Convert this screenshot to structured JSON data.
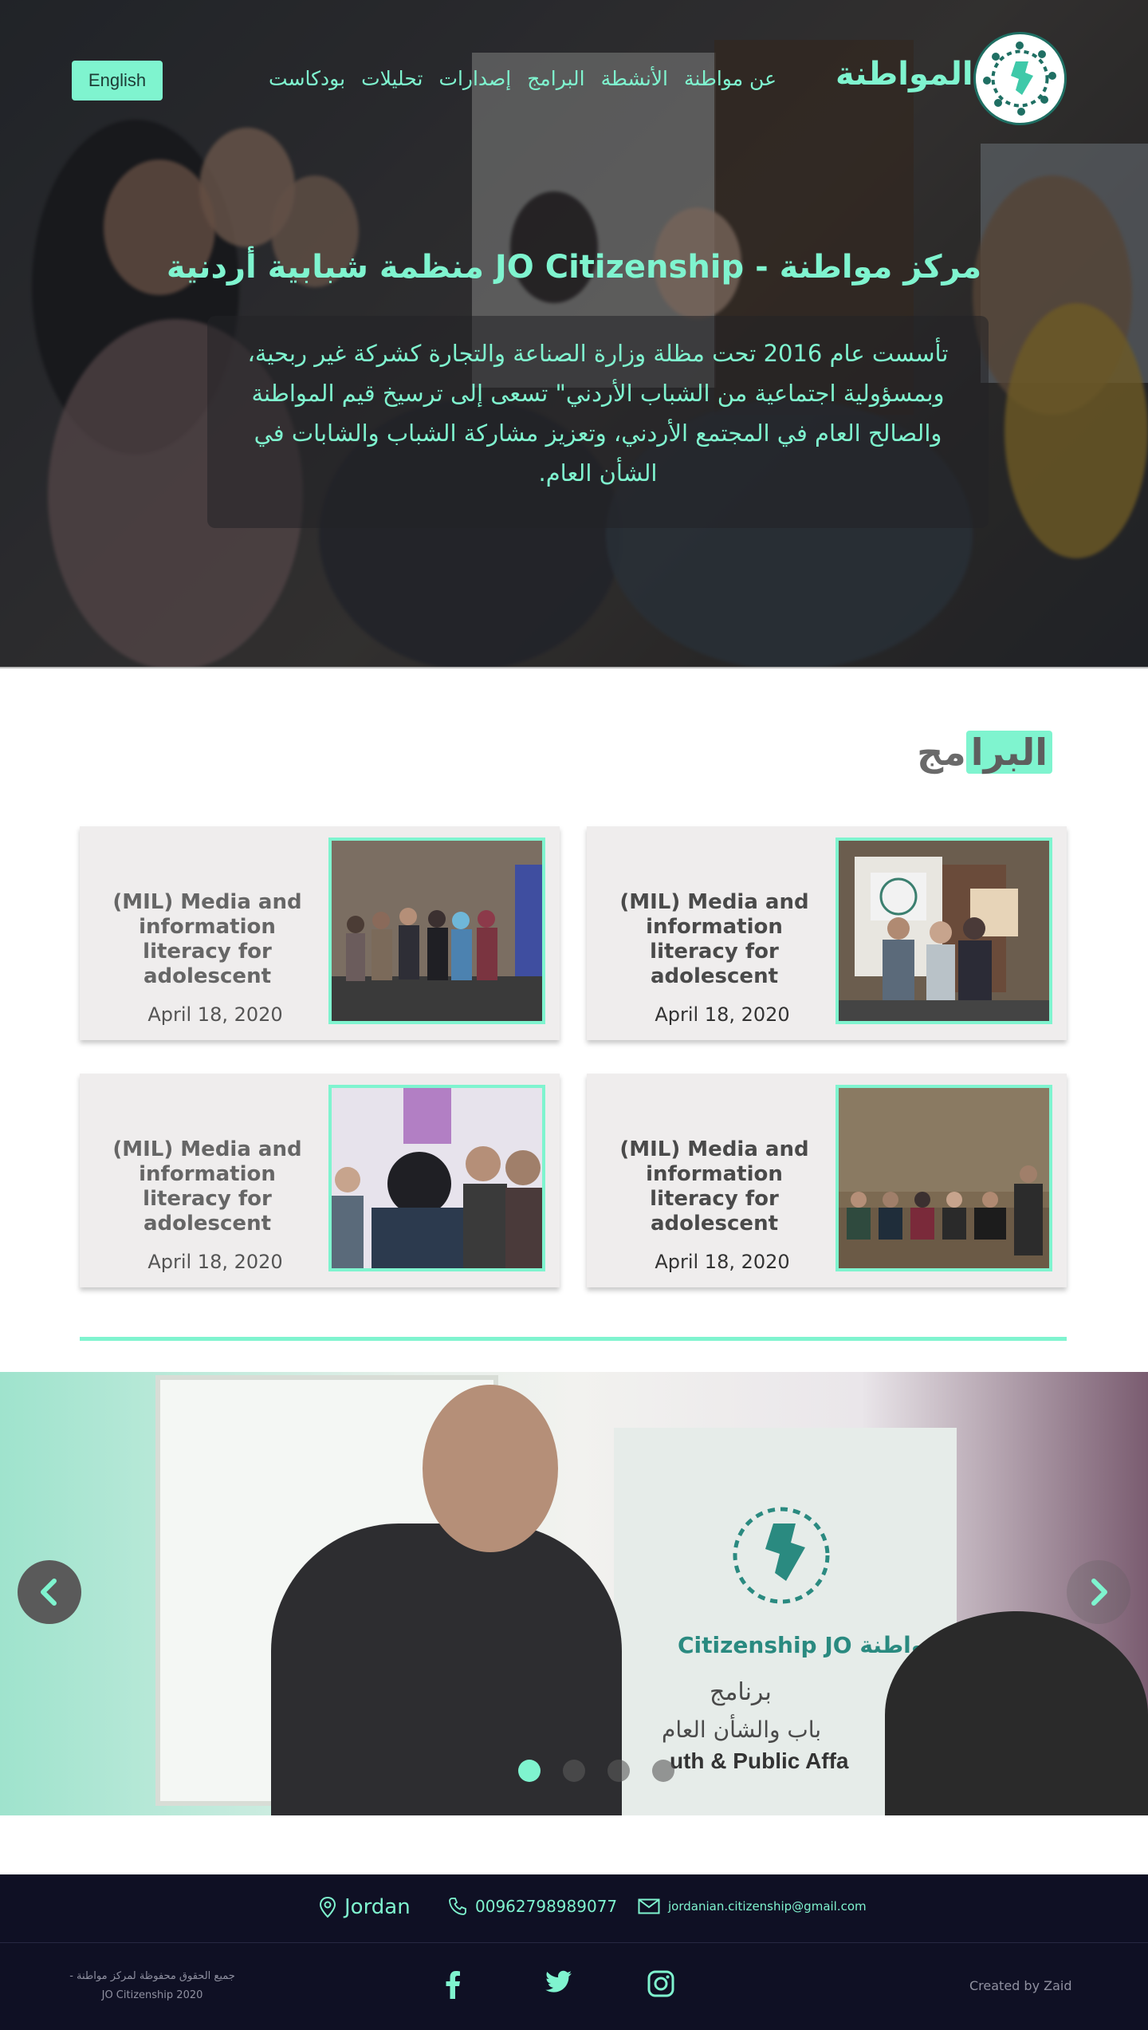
{
  "header": {
    "logo_text": "المواطنة",
    "nav": [
      "عن مواطنة",
      "الأنشطة",
      "البرامج",
      "إصدارات",
      "تحليلات",
      "بودكاست"
    ],
    "language_button": "English"
  },
  "hero": {
    "title": "مركز مواطنة - JO Citizenship منظمة شبابية أردنية",
    "description": "تأسست عام 2016 تحت مظلة وزارة الصناعة والتجارة كشركة غير ربحية، وبمسؤولية اجتماعية من الشباب الأردني\" تسعى إلى ترسيخ قيم المواطنة والصالح العام في المجتمع الأردني، وتعزيز مشاركة الشباب والشابات في الشأن العام."
  },
  "programs": {
    "title_highlight": "البرا",
    "title_rest": "مج",
    "cards": [
      {
        "title": "(MIL) Media and information literacy for adolescent",
        "date": "April 18, 2020"
      },
      {
        "title": "(MIL) Media and information literacy for adolescent",
        "date": "April 18, 2020"
      },
      {
        "title": "(MIL) Media and information literacy for adolescent",
        "date": "April 18, 2020"
      },
      {
        "title": "(MIL) Media and information literacy for adolescent",
        "date": "April 18, 2020"
      }
    ]
  },
  "slider": {
    "sign_title": "Citizenship JO مواطنة",
    "sign_sub": "برنامج",
    "sign_sub2": "باب والشأن العام",
    "sign_sub3": "uth & Public Affa",
    "active_index": 0,
    "dot_count": 4
  },
  "footer": {
    "location": "Jordan",
    "phone": "00962798989077",
    "email": "jordanian.citizenship@gmail.com",
    "copyright_line1": "جميع الحقوق محفوظة لمركز مواطنة -",
    "copyright_line2": "2020 JO Citizenship",
    "credit": "Created by Zaid"
  },
  "colors": {
    "accent": "#7ff4cf",
    "footer_bg": "#0f1024"
  }
}
